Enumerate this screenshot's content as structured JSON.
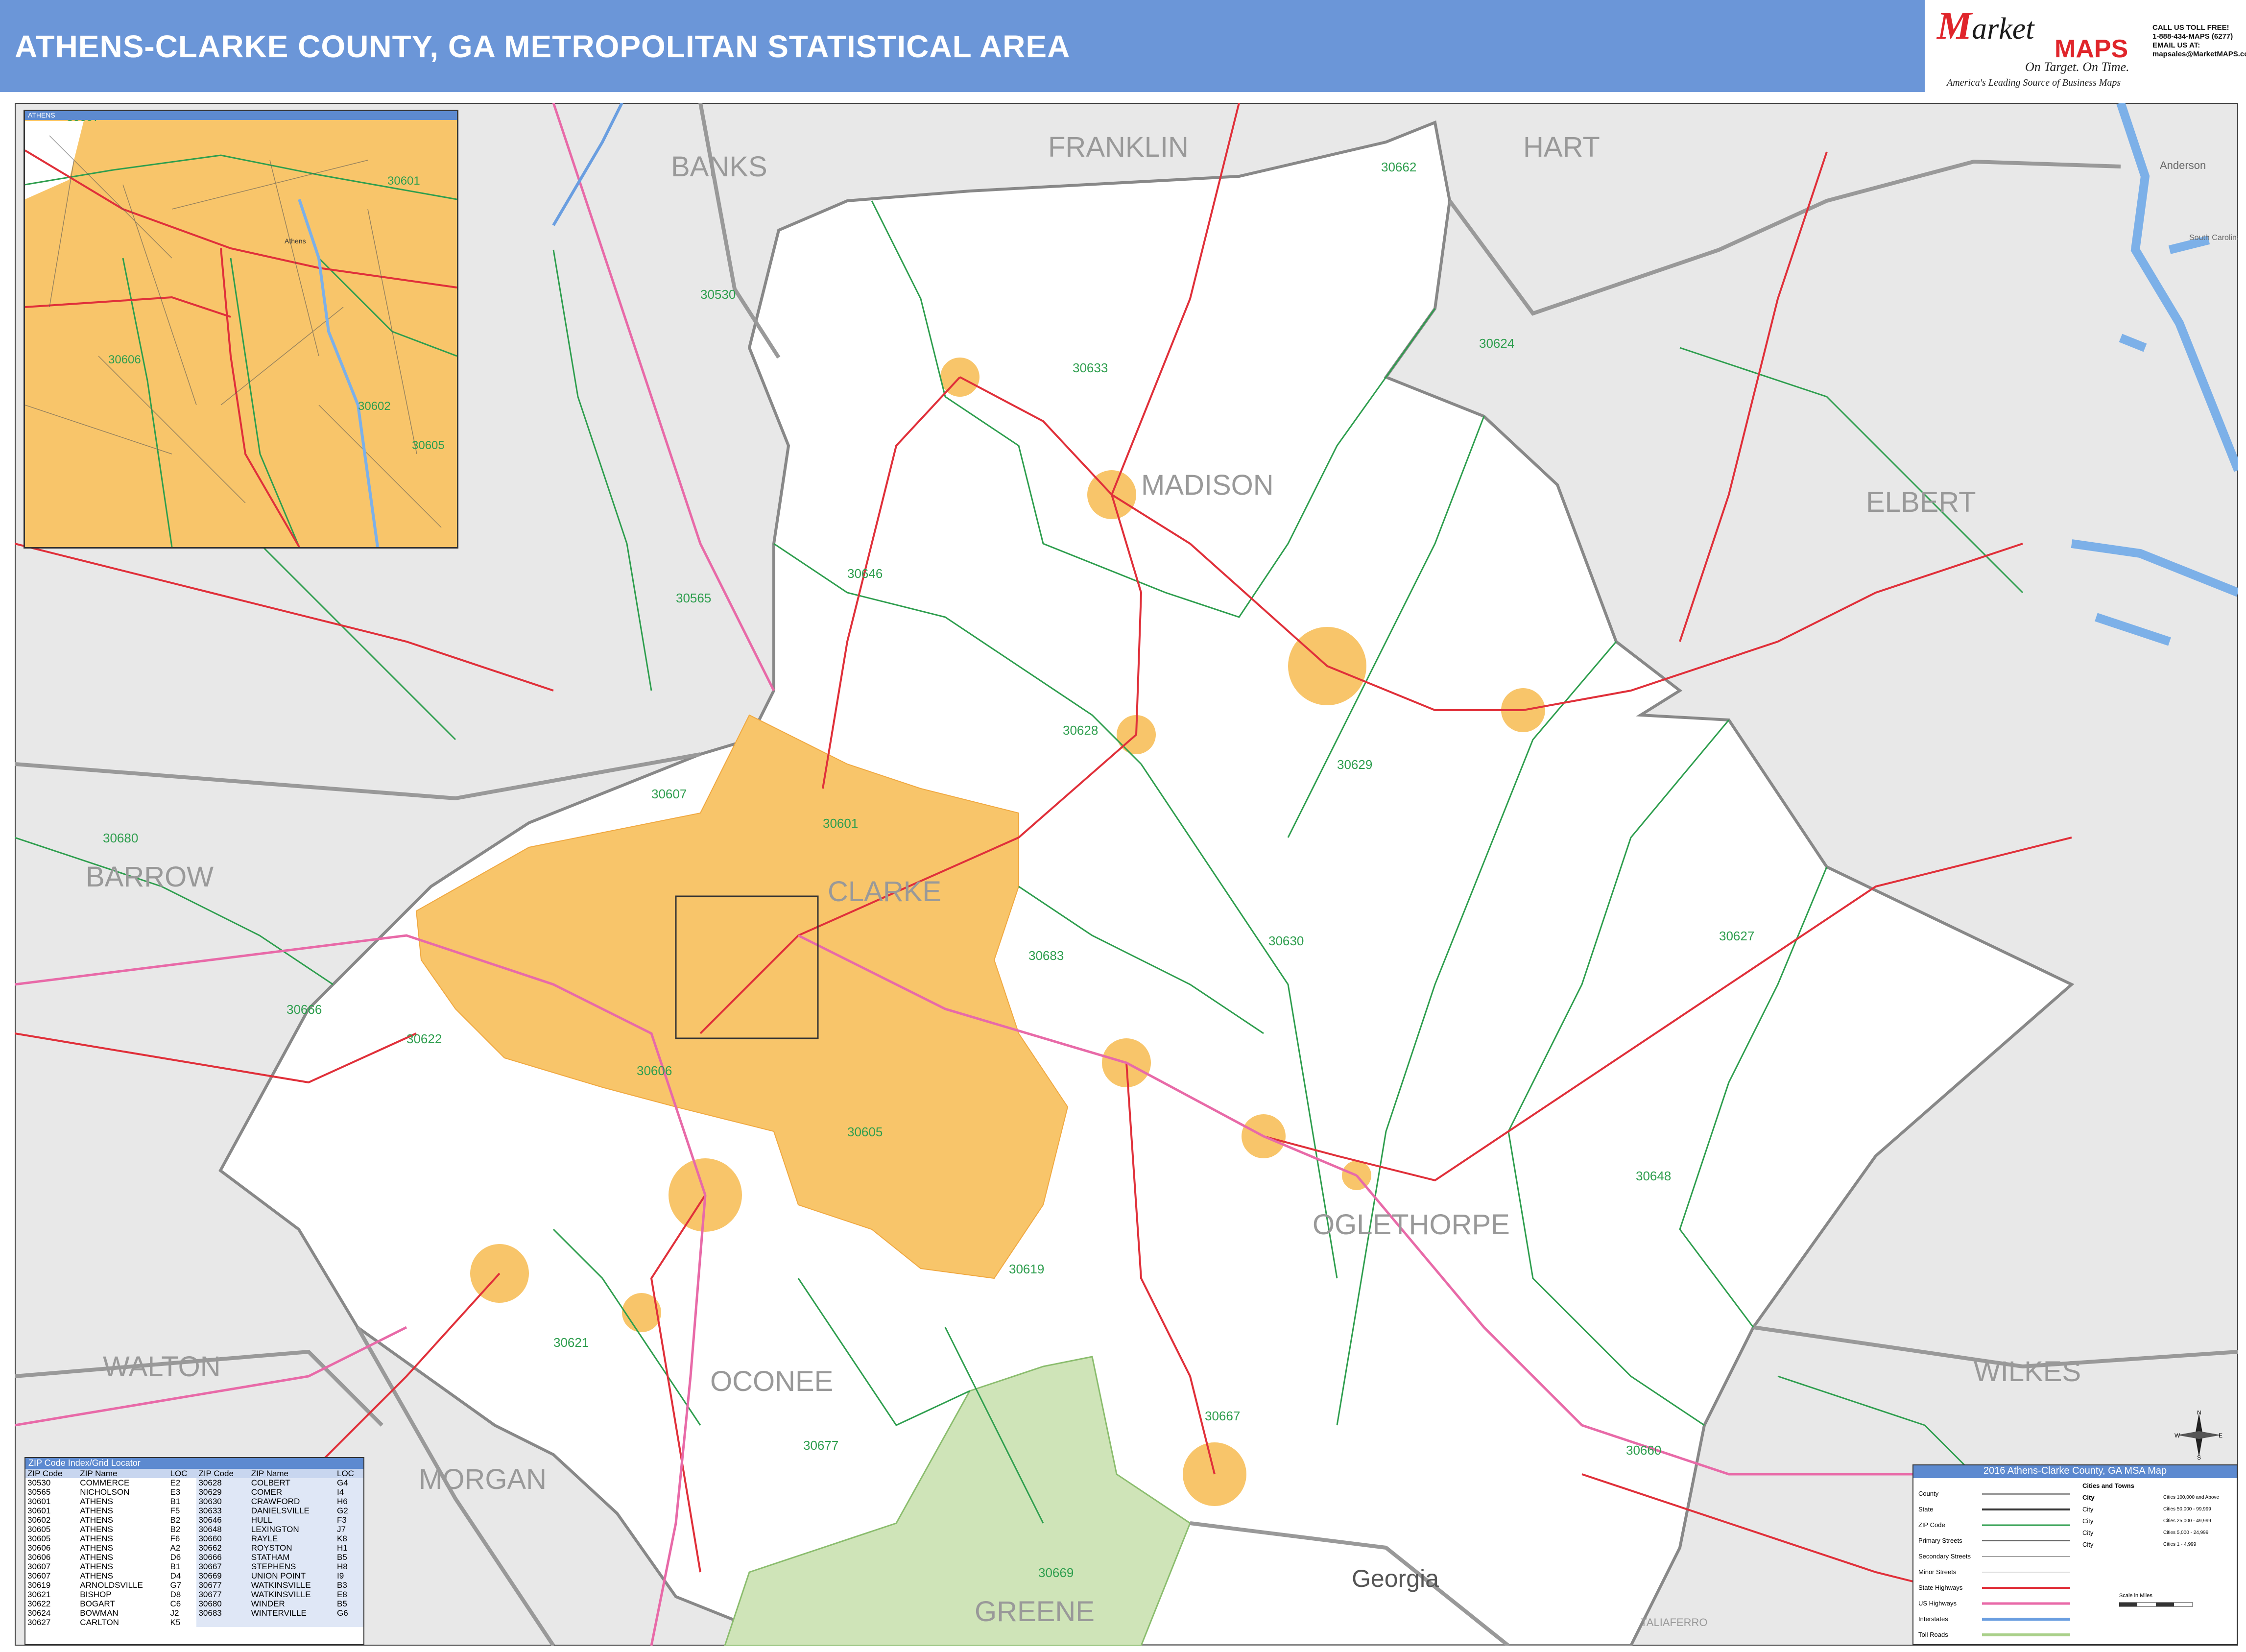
{
  "header": {
    "title": "ATHENS-CLARKE COUNTY, GA METROPOLITAN STATISTICAL AREA"
  },
  "brand": {
    "logo_text": "arket",
    "logo_letter": "M",
    "logo_maps": "MAPS",
    "tagline": "On Target. On Time.",
    "subtagline": "America's Leading Source of Business Maps",
    "contact_lines": [
      "CALL US TOLL FREE!",
      "1-888-434-MAPS (6277)",
      "EMAIL US AT:",
      "mapsales@MarketMAPS.com"
    ]
  },
  "colors": {
    "header_bg": "#6b96d8",
    "msa_fill": "#ffffff",
    "outside_fill": "#e8e8e8",
    "city_fill": "#f8c56a",
    "zip_line": "#2e9e4e",
    "state_highway": "#e0303a",
    "us_highway": "#e86aa8",
    "interstate": "#6a9ee0",
    "water": "#7cb0e8",
    "park": "#cfe4b8",
    "county_line": "#999999"
  },
  "counties": [
    {
      "name": "BANKS"
    },
    {
      "name": "FRANKLIN"
    },
    {
      "name": "HART"
    },
    {
      "name": "MADISON"
    },
    {
      "name": "ELBERT"
    },
    {
      "name": "BARROW"
    },
    {
      "name": "CLARKE"
    },
    {
      "name": "OGLETHORPE"
    },
    {
      "name": "WALTON"
    },
    {
      "name": "OCONEE"
    },
    {
      "name": "WILKES"
    },
    {
      "name": "MORGAN"
    },
    {
      "name": "GREENE"
    },
    {
      "name": "TALIAFERRO"
    }
  ],
  "state_label": "Georgia",
  "zip_labels": [
    "30662",
    "30530",
    "30633",
    "30624",
    "30565",
    "30646",
    "30628",
    "30629",
    "30607",
    "30601",
    "30680",
    "30683",
    "30630",
    "30627",
    "30666",
    "30622",
    "30606",
    "30605",
    "30648",
    "30619",
    "30621",
    "30677",
    "30667",
    "30660",
    "30669",
    "30602"
  ],
  "town_labels": [
    "Anderson",
    "South Carolina",
    "Athens"
  ],
  "inset": {
    "title": "ATHENS",
    "zip_labels": [
      "30607",
      "30601",
      "30606",
      "30602",
      "30605"
    ],
    "place_labels": [
      "Athens"
    ]
  },
  "zip_index": {
    "title": "ZIP Code Index/Grid Locator",
    "headers": [
      "ZIP Code",
      "ZIP Name",
      "LOC",
      "ZIP Code",
      "ZIP Name",
      "LOC"
    ],
    "rows": [
      [
        "30530",
        "COMMERCE",
        "E2",
        "30628",
        "COLBERT",
        "G4"
      ],
      [
        "30565",
        "NICHOLSON",
        "E3",
        "30629",
        "COMER",
        "I4"
      ],
      [
        "30601",
        "ATHENS",
        "B1",
        "30630",
        "CRAWFORD",
        "H6"
      ],
      [
        "30601",
        "ATHENS",
        "F5",
        "30633",
        "DANIELSVILLE",
        "G2"
      ],
      [
        "30602",
        "ATHENS",
        "B2",
        "30646",
        "HULL",
        "F3"
      ],
      [
        "30605",
        "ATHENS",
        "B2",
        "30648",
        "LEXINGTON",
        "J7"
      ],
      [
        "30605",
        "ATHENS",
        "F6",
        "30660",
        "RAYLE",
        "K8"
      ],
      [
        "30606",
        "ATHENS",
        "A2",
        "30662",
        "ROYSTON",
        "H1"
      ],
      [
        "30606",
        "ATHENS",
        "D6",
        "30666",
        "STATHAM",
        "B5"
      ],
      [
        "30607",
        "ATHENS",
        "B1",
        "30667",
        "STEPHENS",
        "H8"
      ],
      [
        "30607",
        "ATHENS",
        "D4",
        "30669",
        "UNION POINT",
        "I9"
      ],
      [
        "30619",
        "ARNOLDSVILLE",
        "G7",
        "30677",
        "WATKINSVILLE",
        "B3"
      ],
      [
        "30621",
        "BISHOP",
        "D8",
        "30677",
        "WATKINSVILLE",
        "E8"
      ],
      [
        "30622",
        "BOGART",
        "C6",
        "30680",
        "WINDER",
        "B5"
      ],
      [
        "30624",
        "BOWMAN",
        "J2",
        "30683",
        "WINTERVILLE",
        "G6"
      ],
      [
        "30627",
        "CARLTON",
        "K5",
        "",
        "",
        "",
        ""
      ]
    ]
  },
  "legend": {
    "title": "2016 Athens-Clarke County, GA MSA Map",
    "left_items": [
      "County",
      "State",
      "ZIP Code",
      "Primary Streets",
      "Secondary Streets",
      "Minor Streets",
      "State Highways",
      "US Highways",
      "Interstates",
      "Toll Roads"
    ],
    "right_title": "Cities and Towns",
    "right_items": [
      {
        "label": "City",
        "range": "Cities 100,000 and Above"
      },
      {
        "label": "City",
        "range": "Cities 50,000 - 99,999"
      },
      {
        "label": "City",
        "range": "Cities 25,000 - 49,999"
      },
      {
        "label": "City",
        "range": "Cities 5,000 - 24,999"
      },
      {
        "label": "City",
        "range": "Cities 1 - 4,999"
      }
    ],
    "scale_label": "Scale in Miles"
  },
  "compass": {
    "n": "N",
    "s": "S",
    "e": "E",
    "w": "W"
  }
}
